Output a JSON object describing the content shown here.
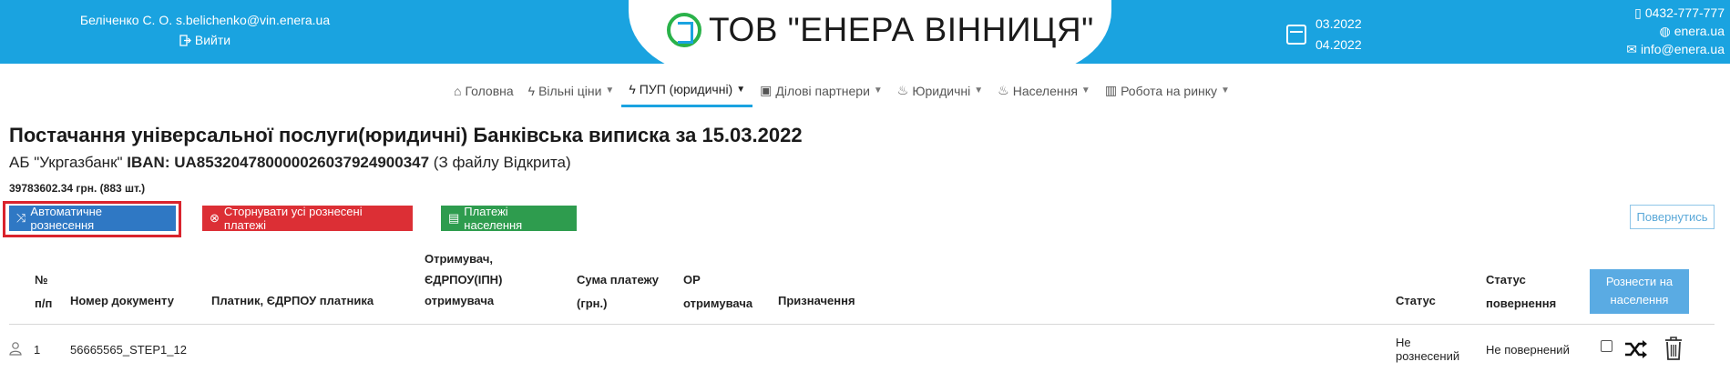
{
  "header": {
    "user": "Беліченко С. О. s.belichenko@vin.enera.ua",
    "logout_label": "Вийти",
    "logo_text": "ТОВ \"ЕНЕРА ВІННИЦЯ\"",
    "date_from": "03.2022",
    "date_to": "04.2022",
    "phone": "0432-777-777",
    "site": "enera.ua",
    "email": "info@enera.ua"
  },
  "nav": {
    "items": [
      {
        "label": "Головна",
        "icon": "home-icon",
        "dropdown": false
      },
      {
        "label": "Вільні ціни",
        "icon": "bolt-icon",
        "dropdown": true
      },
      {
        "label": "ПУП (юридичні)",
        "icon": "bolt-icon",
        "dropdown": true,
        "active": true
      },
      {
        "label": "Ділові партнери",
        "icon": "id-card-icon",
        "dropdown": true
      },
      {
        "label": "Юридичні",
        "icon": "flame-icon",
        "dropdown": true
      },
      {
        "label": "Населення",
        "icon": "flame-icon",
        "dropdown": true
      },
      {
        "label": "Робота на ринку",
        "icon": "chart-icon",
        "dropdown": true
      }
    ]
  },
  "page": {
    "title": "Постачання універсальної послуги(юридичні) Банківська виписка за 15.03.2022",
    "bank": "АБ \"Укргазбанк\"",
    "iban_label": "IBAN:",
    "iban": "UA853204780000026037924900347",
    "file_note": "(З файлу Відкрита)",
    "total": "39783602.34 грн. (883 шт.)"
  },
  "toolbar": {
    "auto_label": "Автоматичне рознесення",
    "storn_label": "Сторнувати усі рознесені платежі",
    "payments_label": "Платежі населення",
    "back_label": "Повернутись"
  },
  "table": {
    "headers": {
      "num_1": "№",
      "num_2": "п/п",
      "doc": "Номер документу",
      "payer": "Платник, ЄДРПОУ платника",
      "recipient_1": "Отримувач,",
      "recipient_2": "ЄДРПОУ(ІПН)",
      "recipient_3": "отримувача",
      "sum_1": "Сума платежу",
      "sum_2": "(грн.)",
      "or_1": "ОР",
      "or_2": "отримувача",
      "purpose": "Призначення",
      "status": "Статус",
      "return_1": "Статус",
      "return_2": "повернення",
      "rozn_button": "Рознести на населення"
    },
    "rows": [
      {
        "num": "1",
        "doc": "56665565_STEP1_12",
        "status_1": "Не",
        "status_2": "рознесений",
        "return_status": "Не повернений"
      }
    ]
  },
  "colors": {
    "header_bg": "#1aa3e0",
    "auto_button": "#2f78c4",
    "storn_button": "#dc2f35",
    "payments_button": "#2e9c4e",
    "highlight_frame": "#d9232d"
  }
}
